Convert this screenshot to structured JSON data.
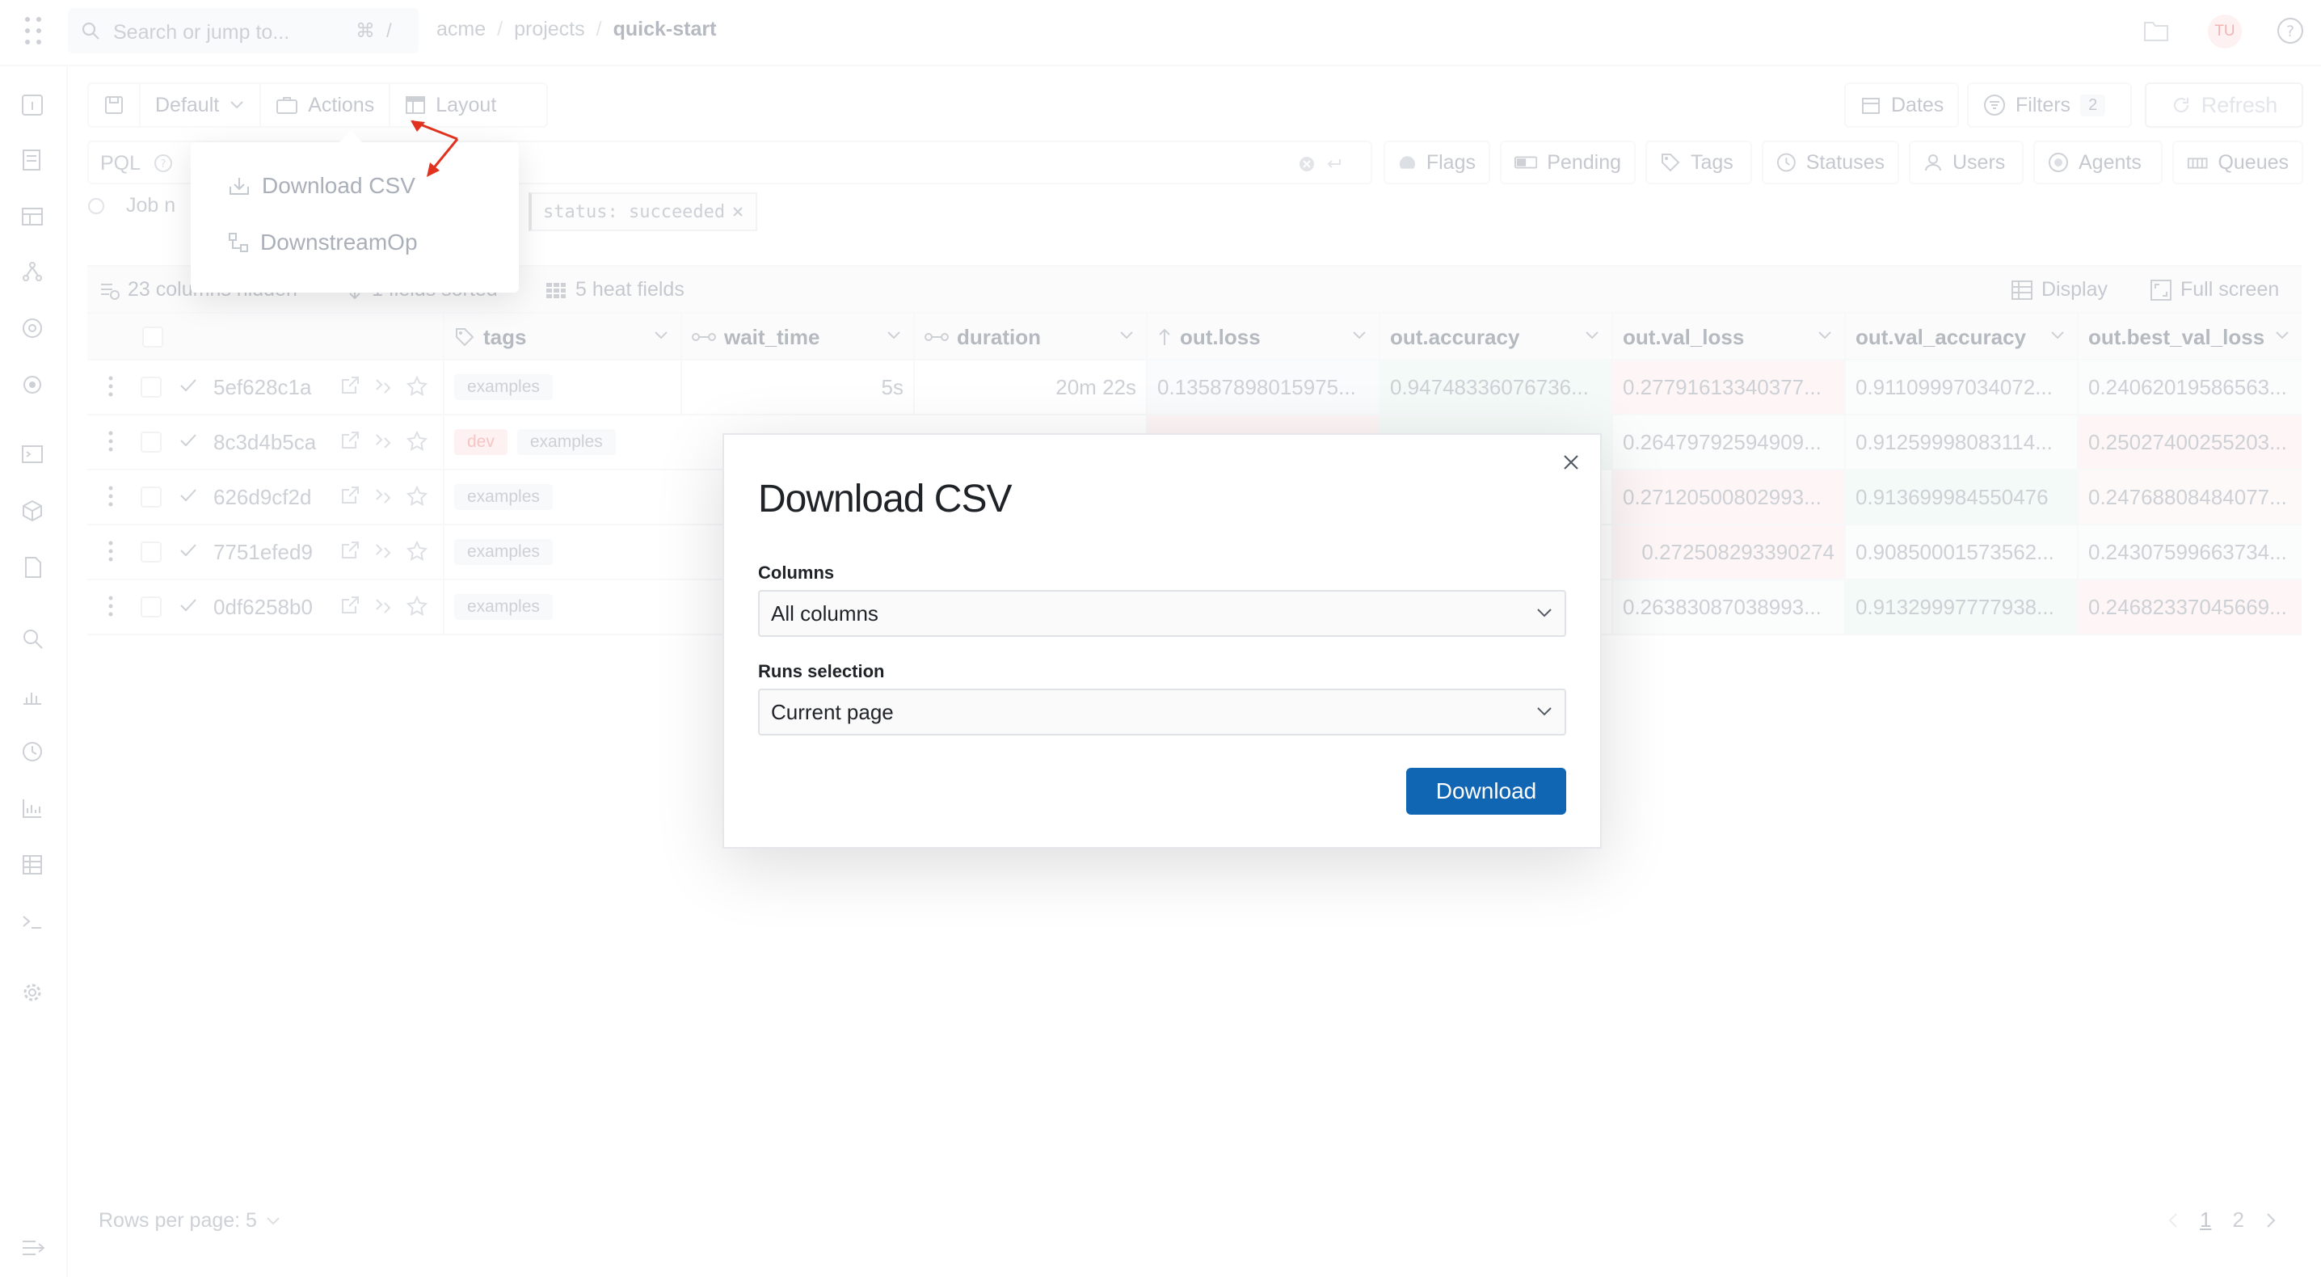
{
  "topbar": {
    "search_placeholder": "Search or jump to...",
    "kbd_cmd": "⌘",
    "kbd_slash": "/",
    "breadcrumb": [
      "acme",
      "projects",
      "quick-start"
    ],
    "avatar_initials": "TU"
  },
  "toolbar": {
    "view_label": "Default",
    "actions_label": "Actions",
    "layout_label": "Layout",
    "dates_label": "Dates",
    "filters_label": "Filters",
    "filters_count": "2",
    "refresh_label": "Refresh"
  },
  "pql": {
    "label": "PQL"
  },
  "quick_filters": [
    "Flags",
    "Pending",
    "Tags",
    "Statuses",
    "Users",
    "Agents",
    "Queues"
  ],
  "chips": {
    "job_label": "Job n",
    "status_chip": "status: succeeded"
  },
  "metabar": {
    "columns_hidden": "23 columns hidden",
    "fields_sorted": "1 fields sorted",
    "heat_fields": "5 heat fields",
    "display_label": "Display",
    "fullscreen_label": "Full screen"
  },
  "table": {
    "headers": [
      "tags",
      "wait_time",
      "duration",
      "out.loss",
      "out.accuracy",
      "out.val_loss",
      "out.val_accuracy",
      "out.best_val_loss"
    ],
    "rows": [
      {
        "id": "5ef628c1a",
        "tags": [
          "examples"
        ],
        "wait_time": "5s",
        "duration": "20m 22s",
        "out_loss": "0.13587898015975...",
        "out_accuracy": "0.94748336076736...",
        "out_val_loss": "0.27791613340377...",
        "out_val_accuracy": "0.91109997034072...",
        "out_best_val_loss": "0.24062019586563..."
      },
      {
        "id": "8c3d4b5ca",
        "tags": [
          "dev",
          "examples"
        ],
        "wait_time": "",
        "duration": "",
        "out_loss": "",
        "out_accuracy": "",
        "out_val_loss": "0.26479792594909...",
        "out_val_accuracy": "0.91259998083114...",
        "out_best_val_loss": "0.25027400255203..."
      },
      {
        "id": "626d9cf2d",
        "tags": [
          "examples"
        ],
        "wait_time": "",
        "duration": "",
        "out_loss": "",
        "out_accuracy": "",
        "out_val_loss": "0.27120500802993...",
        "out_val_accuracy": "0.913699984550476",
        "out_best_val_loss": "0.24768808484077..."
      },
      {
        "id": "7751efed9",
        "tags": [
          "examples"
        ],
        "wait_time": "",
        "duration": "",
        "out_loss": "",
        "out_accuracy": "",
        "out_val_loss": "0.272508293390274",
        "out_val_accuracy": "0.90850001573562...",
        "out_best_val_loss": "0.24307599663734..."
      },
      {
        "id": "0df6258b0",
        "tags": [
          "examples"
        ],
        "wait_time": "",
        "duration": "",
        "out_loss": "",
        "out_accuracy": "",
        "out_val_loss": "0.26383087038993...",
        "out_val_accuracy": "0.91329997777938...",
        "out_best_val_loss": "0.24682337045669..."
      }
    ]
  },
  "actions_menu": {
    "items": [
      "Download CSV",
      "DownstreamOp"
    ]
  },
  "modal": {
    "title": "Download CSV",
    "columns_label": "Columns",
    "columns_value": "All columns",
    "runs_label": "Runs selection",
    "runs_value": "Current page",
    "download_label": "Download"
  },
  "footer": {
    "rows_per_page": "Rows per page: 5",
    "page_1": "1",
    "page_2": "2"
  },
  "colors": {
    "primary": "#1166b3",
    "heat_red": "#fdecec",
    "heat_green": "#e9f4ee",
    "annotation": "#e0321f"
  }
}
